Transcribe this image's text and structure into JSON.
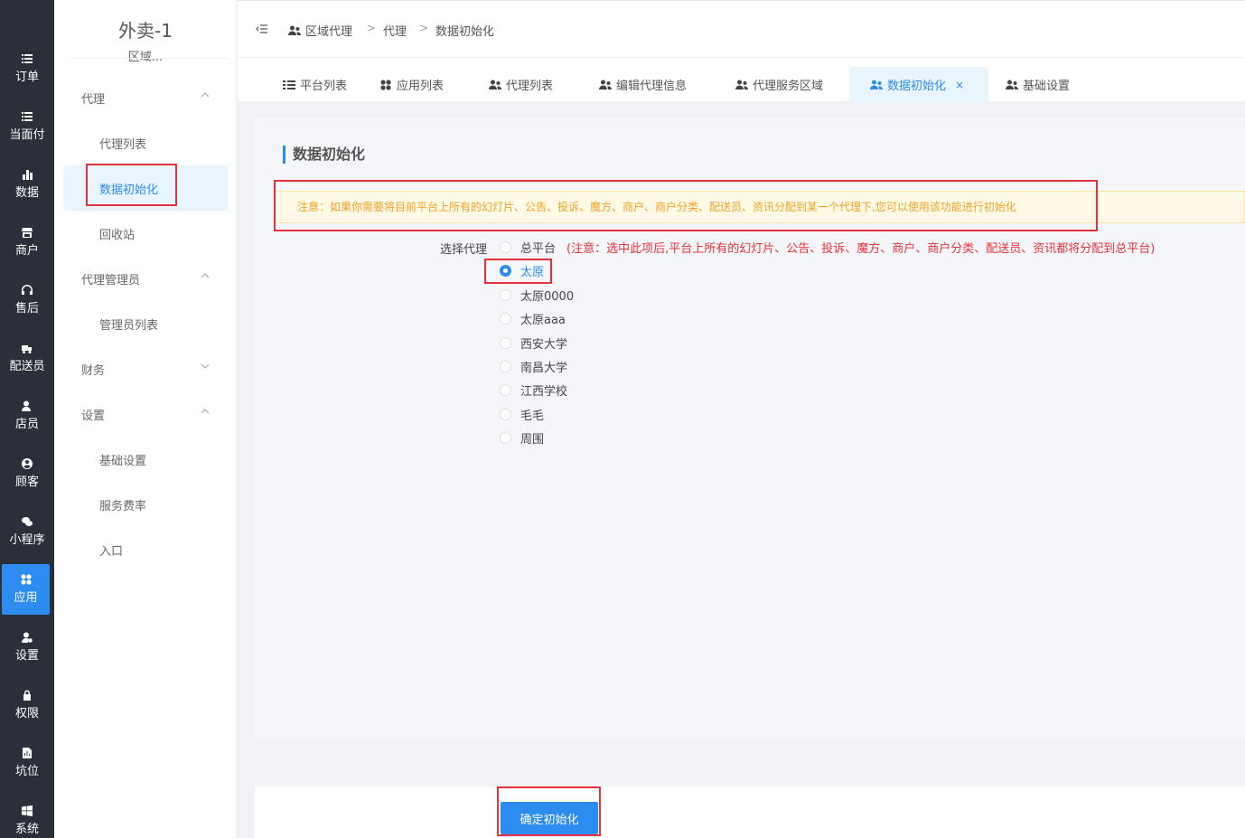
{
  "rail": [
    {
      "label": "订单",
      "icon": "list-icon"
    },
    {
      "label": "当面付",
      "icon": "list-icon"
    },
    {
      "label": "数据",
      "icon": "bar-chart-icon"
    },
    {
      "label": "商户",
      "icon": "store-icon"
    },
    {
      "label": "售后",
      "icon": "headset-icon"
    },
    {
      "label": "配送员",
      "icon": "delivery-icon"
    },
    {
      "label": "店员",
      "icon": "user-icon"
    },
    {
      "label": "顾客",
      "icon": "customer-icon"
    },
    {
      "label": "小程序",
      "icon": "wechat-icon"
    },
    {
      "label": "应用",
      "icon": "apps-icon"
    },
    {
      "label": "设置",
      "icon": "settings-user-icon"
    },
    {
      "label": "权限",
      "icon": "lock-icon"
    },
    {
      "label": "坑位",
      "icon": "document-chart-icon"
    },
    {
      "label": "系统",
      "icon": "windows-icon"
    }
  ],
  "sidebar": {
    "title": "外卖-1",
    "subtitle": "区域...",
    "group_agent": "代理",
    "item_agent_list": "代理列表",
    "item_data_init": "数据初始化",
    "item_recycle": "回收站",
    "group_admin": "代理管理员",
    "item_admin_list": "管理员列表",
    "group_finance": "财务",
    "group_settings": "设置",
    "item_basic": "基础设置",
    "item_fee": "服务费率",
    "item_entry": "入口"
  },
  "breadcrumb": {
    "c1": "区域代理",
    "sep": ">",
    "c2": "代理",
    "c3": "数据初始化"
  },
  "tabs": [
    {
      "label": "平台列表"
    },
    {
      "label": "应用列表"
    },
    {
      "label": "代理列表"
    },
    {
      "label": "编辑代理信息"
    },
    {
      "label": "代理服务区域"
    },
    {
      "label": "数据初始化",
      "close": "×"
    },
    {
      "label": "基础设置"
    }
  ],
  "main": {
    "heading": "数据初始化",
    "notice": "注意：如果你需要将目前平台上所有的幻灯片、公告、投诉、魔方、商户、商户分类、配送员、资讯分配到某一个代理下,您可以使用该功能进行初始化",
    "select_label": "选择代理",
    "options": [
      {
        "label": "总平台",
        "note": "(注意：选中此项后,平台上所有的幻灯片、公告、投诉、魔方、商户、商户分类、配送员、资讯都将分配到总平台)"
      },
      {
        "label": "太原"
      },
      {
        "label": "太原0000"
      },
      {
        "label": "太原aaa"
      },
      {
        "label": "西安大学"
      },
      {
        "label": "南昌大学"
      },
      {
        "label": "江西学校"
      },
      {
        "label": "毛毛"
      },
      {
        "label": "周围"
      }
    ],
    "selected": "太原",
    "submit": "确定初始化"
  },
  "colors": {
    "accent": "#2d8cf0",
    "rail": "#2b2f3a",
    "highlight": "#e8303a",
    "notice_text": "#f1a325"
  }
}
